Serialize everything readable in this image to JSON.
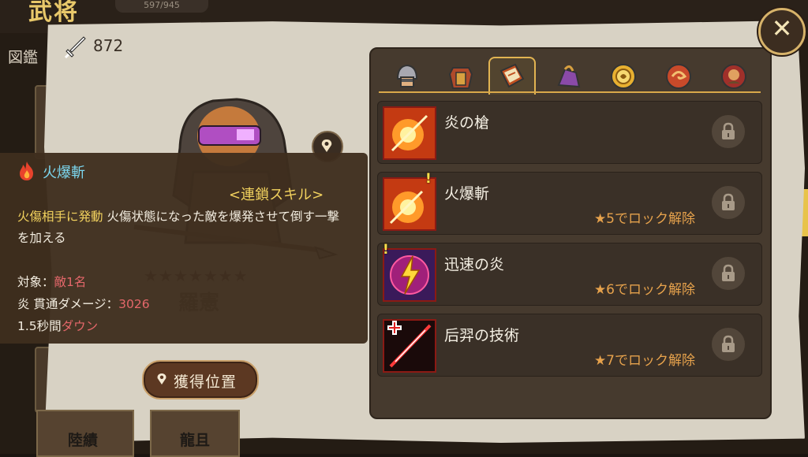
{
  "background": {
    "title": "武将",
    "count": "597/945",
    "zukan": "図鑑",
    "bottom_cards": [
      "陸績",
      "龍且"
    ]
  },
  "hero": {
    "power": "872",
    "name": "羅憲",
    "stars_text": "★★★★★★★",
    "acquire_button": "獲得位置"
  },
  "skill_info": {
    "name": "火爆斬",
    "chain_label": "<連鎖スキル>",
    "condition": "火傷相手に発動",
    "description": " 火傷状態になった敵を爆発させて倒す一撃を加える",
    "target_label": "対象：",
    "target_value": "敵1名",
    "damage_label": "炎 貫通ダメージ：",
    "damage_value": "3026",
    "down_prefix": "1.5秒間",
    "down_value": "ダウン"
  },
  "tabs": [
    {
      "name": "helmet",
      "active": false
    },
    {
      "name": "armor",
      "active": false
    },
    {
      "name": "skill-book",
      "active": true
    },
    {
      "name": "accessory",
      "active": false
    },
    {
      "name": "token",
      "active": false
    },
    {
      "name": "shield",
      "active": false
    },
    {
      "name": "portrait",
      "active": false
    }
  ],
  "skills": [
    {
      "title": "炎の槍",
      "unlock": ""
    },
    {
      "title": "火爆斬",
      "unlock": "★5でロック解除"
    },
    {
      "title": "迅速の炎",
      "unlock": "★6でロック解除"
    },
    {
      "title": "后羿の技術",
      "unlock": "★7でロック解除"
    }
  ],
  "colors": {
    "accent_gold": "#e2b452",
    "unlock_orange": "#e6a24c",
    "damage_red": "#e4676a",
    "skill_name_cyan": "#7bd6ee"
  }
}
